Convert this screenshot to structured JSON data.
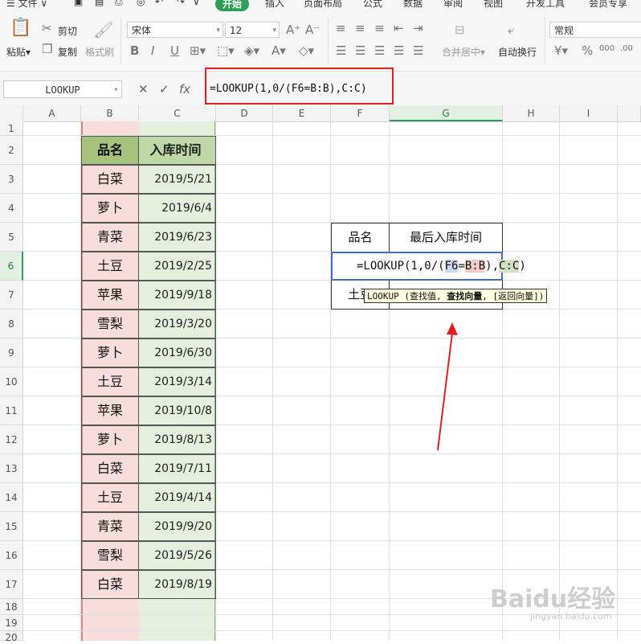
{
  "menu": {
    "file": "文件",
    "tabs": [
      "开始",
      "插入",
      "页面布局",
      "公式",
      "数据",
      "审阅",
      "视图",
      "开发工具",
      "会员专享"
    ],
    "active_tab": "开始"
  },
  "ribbon": {
    "paste": "粘贴",
    "cut": "剪切",
    "copy": "复制",
    "format_painter": "格式刷",
    "font_name": "宋体",
    "font_size": "12",
    "merge_center": "合并居中",
    "wrap_text": "自动换行",
    "number_format": "常规"
  },
  "formula_bar": {
    "name_box": "LOOKUP",
    "fx": "fx",
    "formula": "=LOOKUP(1,0/(F6=B:B),C:C)"
  },
  "columns": [
    "A",
    "B",
    "C",
    "D",
    "E",
    "F",
    "G",
    "H",
    "I"
  ],
  "rows": [
    "1",
    "2",
    "3",
    "4",
    "5",
    "6",
    "7",
    "8",
    "9",
    "10",
    "11",
    "12",
    "13",
    "14",
    "15",
    "16",
    "17",
    "18",
    "19",
    "20"
  ],
  "table": {
    "header_name": "品名",
    "header_date": "入库时间",
    "items": [
      {
        "name": "白菜",
        "date": "2019/5/21"
      },
      {
        "name": "萝卜",
        "date": "2019/6/4"
      },
      {
        "name": "青菜",
        "date": "2019/6/23"
      },
      {
        "name": "土豆",
        "date": "2019/2/25"
      },
      {
        "name": "苹果",
        "date": "2019/9/18"
      },
      {
        "name": "雪梨",
        "date": "2019/3/20"
      },
      {
        "name": "萝卜",
        "date": "2019/6/30"
      },
      {
        "name": "土豆",
        "date": "2019/3/14"
      },
      {
        "name": "苹果",
        "date": "2019/10/8"
      },
      {
        "name": "萝卜",
        "date": "2019/8/13"
      },
      {
        "name": "白菜",
        "date": "2019/7/11"
      },
      {
        "name": "土豆",
        "date": "2019/4/14"
      },
      {
        "name": "青菜",
        "date": "2019/9/20"
      },
      {
        "name": "雪梨",
        "date": "2019/5/26"
      },
      {
        "name": "白菜",
        "date": "2019/8/19"
      }
    ]
  },
  "lookup_table": {
    "header_name": "品名",
    "header_date": "最后入库时间",
    "row7_name": "土豆",
    "edit_prefix": "=LOOKUP(1,0/(",
    "edit_ref_f6": "F6",
    "edit_eq": "=",
    "edit_ref_bb": "B:B",
    "edit_mid": "),",
    "edit_ref_cc": "C:C",
    "edit_suffix": ")",
    "tooltip_prefix": "LOOKUP (查找值, ",
    "tooltip_bold": "查找向量",
    "tooltip_suffix": ", [返回向量])"
  },
  "watermark": "Baidu经验",
  "watermark_sub": "jingyan.baidu.com",
  "colors": {
    "accent": "#2f9e58",
    "highlight_red": "#e02020",
    "arrow": "#e02020"
  }
}
